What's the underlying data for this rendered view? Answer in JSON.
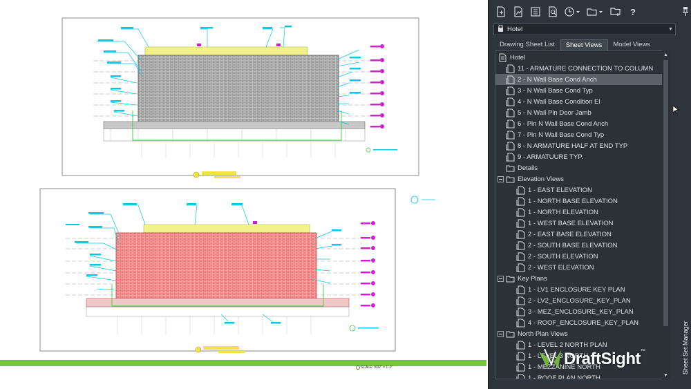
{
  "colors": {
    "panel_bg": "#2d343b",
    "selected_row": "#5a6169",
    "green_bar": "#7cc242",
    "cad_cyan": "#00c8e6",
    "cad_red": "#e95555",
    "cad_yellow": "#f2f28c",
    "cad_magenta": "#d21ed2"
  },
  "toolbar": {
    "icons": [
      "new-sheet-icon",
      "import-layout-icon",
      "publish-icon",
      "preview-icon",
      "history-icon",
      "folder-icon",
      "sheet-set-icon",
      "help-icon"
    ],
    "help_label": "?"
  },
  "sheet_set": {
    "value": "Hotel"
  },
  "tabs": [
    {
      "label": "Drawing Sheet List",
      "active": false
    },
    {
      "label": "Sheet Views",
      "active": true
    },
    {
      "label": "Model Views",
      "active": false
    }
  ],
  "tree": {
    "root": "Hotel",
    "items": [
      {
        "label": "11 - ARMATURE CONNECTION TO COLUMN",
        "type": "view",
        "level": 1
      },
      {
        "label": "2 - N Wall Base Cond Anch",
        "type": "view",
        "level": 1,
        "selected": true
      },
      {
        "label": "3 - N Wall Base Cond Typ",
        "type": "view",
        "level": 1
      },
      {
        "label": "4 - N Wall Base Condition El",
        "type": "view",
        "level": 1
      },
      {
        "label": "5 - N Wall Pln Door Jamb",
        "type": "view",
        "level": 1
      },
      {
        "label": "6 - Pln N Wall Base Cond Anch",
        "type": "view",
        "level": 1
      },
      {
        "label": "7 - Pln N Wall Base Cond Typ",
        "type": "view",
        "level": 1
      },
      {
        "label": "8 - N ARMATURE HALF AT END TYP",
        "type": "view",
        "level": 1
      },
      {
        "label": "9 - ARMATUURE TYP.",
        "type": "view",
        "level": 1
      },
      {
        "label": "Details",
        "type": "folder",
        "level": 1
      },
      {
        "label": "Elevation Views",
        "type": "folder",
        "level": 1,
        "expanded": true
      },
      {
        "label": "1 - EAST ELEVATION",
        "type": "view",
        "level": 2
      },
      {
        "label": "1 - NORTH BASE ELEVATION",
        "type": "view",
        "level": 2
      },
      {
        "label": "1 - NORTH ELEVATION",
        "type": "view",
        "level": 2
      },
      {
        "label": "1 - WEST BASE ELEVATION",
        "type": "view",
        "level": 2
      },
      {
        "label": "2 - EAST BASE ELEVATION",
        "type": "view",
        "level": 2
      },
      {
        "label": "2 - SOUTH BASE ELEVATION",
        "type": "view",
        "level": 2
      },
      {
        "label": "2 - SOUTH ELEVATION",
        "type": "view",
        "level": 2
      },
      {
        "label": "2 - WEST ELEVATION",
        "type": "view",
        "level": 2
      },
      {
        "label": "Key Plans",
        "type": "folder",
        "level": 1,
        "expanded": true
      },
      {
        "label": "1 - LV1 ENCLOSURE KEY PLAN",
        "type": "view",
        "level": 2
      },
      {
        "label": "2 - LV2_ENCLOSURE_KEY_PLAN",
        "type": "view",
        "level": 2
      },
      {
        "label": "3 - MEZ_ENCLOSURE_KEY_PLAN",
        "type": "view",
        "level": 2
      },
      {
        "label": "4 - ROOF_ENCLOSURE_KEY_PLAN",
        "type": "view",
        "level": 2
      },
      {
        "label": "North Plan Views",
        "type": "folder",
        "level": 1,
        "expanded": true
      },
      {
        "label": "1 - LEVEL 2 NORTH PLAN",
        "type": "view",
        "level": 2
      },
      {
        "label": "1 - LEVEL 3 NORTH",
        "type": "view",
        "level": 2
      },
      {
        "label": "1 - MEZZANINE NORTH",
        "type": "view",
        "level": 2
      },
      {
        "label": "1 - ROOF PLAN NORTH",
        "type": "view",
        "level": 2
      }
    ]
  },
  "side_tab": "Sheet Set Manager",
  "logo": {
    "text": "DraftSight",
    "mark": "™"
  },
  "drawing": {
    "scale_note": "SCALE: 3/32\" = 1'-0\""
  }
}
